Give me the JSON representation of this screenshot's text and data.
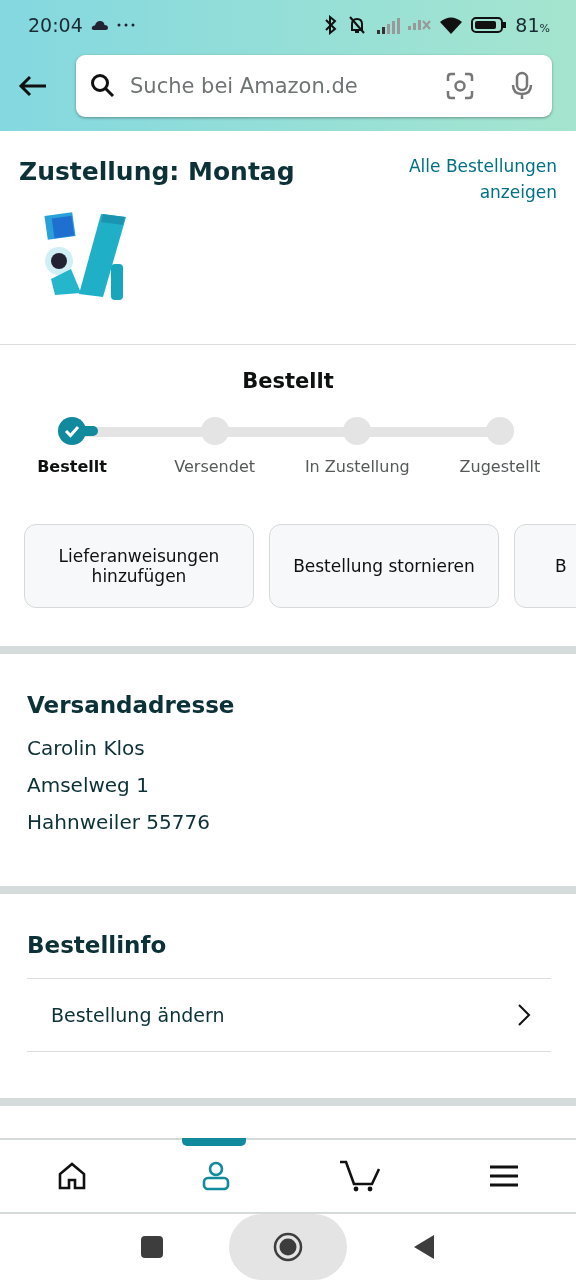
{
  "status_bar": {
    "time": "20:04",
    "battery": "81",
    "battery_unit": "%"
  },
  "search": {
    "placeholder": "Suche bei Amazon.de"
  },
  "delivery": {
    "title": "Zustellung: Montag",
    "link": "Alle Bestellungen anzeigen"
  },
  "tracking": {
    "status": "Bestellt",
    "steps": [
      {
        "label": "Bestellt",
        "done": true
      },
      {
        "label": "Versendet",
        "done": false
      },
      {
        "label": "In Zustellung",
        "done": false
      },
      {
        "label": "Zugestellt",
        "done": false
      }
    ]
  },
  "actions": [
    "Lieferanweisungen hinzufügen",
    "Bestellung stornieren",
    "B"
  ],
  "address": {
    "title": "Versandadresse",
    "lines": [
      "Carolin Klos",
      "Amselweg 1",
      "Hahnweiler 55776"
    ]
  },
  "order_info": {
    "title": "Bestellinfo",
    "items": [
      "Bestellung ändern"
    ]
  },
  "bottom_nav": [
    {
      "kind": "home",
      "selected": false
    },
    {
      "kind": "account",
      "selected": true
    },
    {
      "kind": "cart",
      "selected": false
    },
    {
      "kind": "menu",
      "selected": false
    }
  ]
}
